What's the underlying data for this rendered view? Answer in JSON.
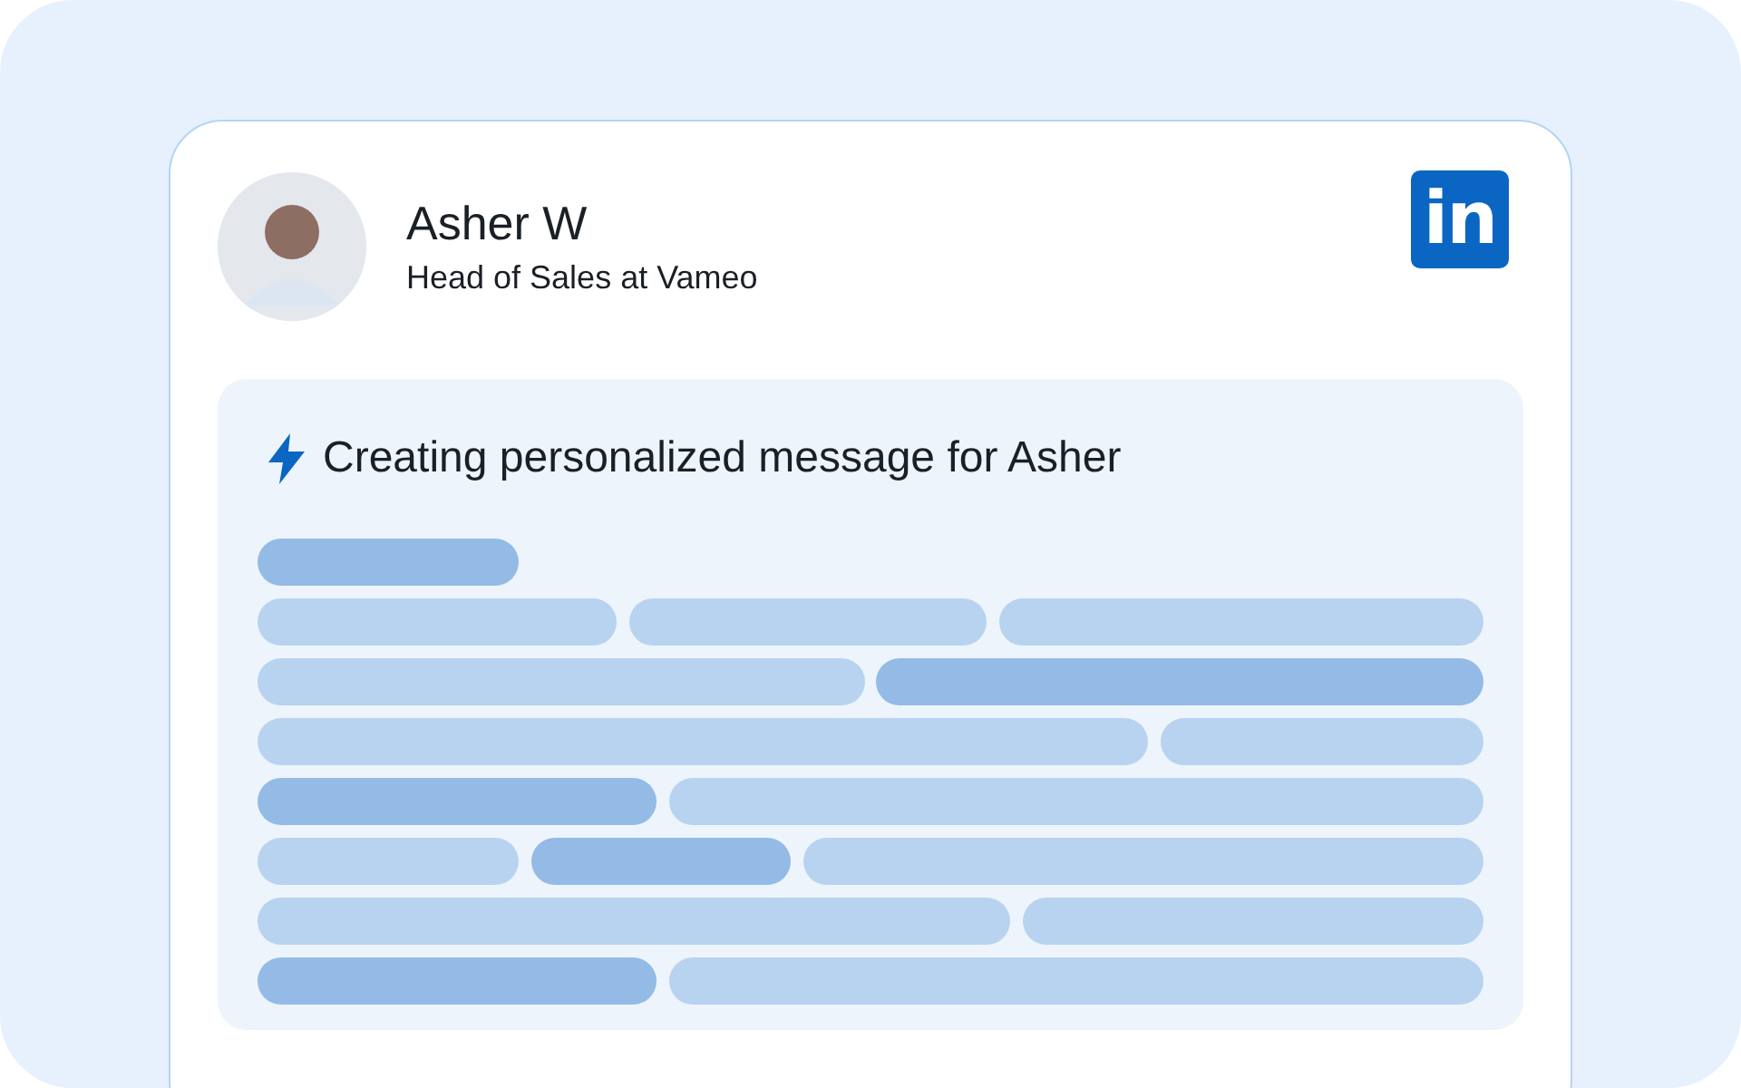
{
  "profile": {
    "name": "Asher W",
    "headline": "Head of Sales at Vameo",
    "logo": "in"
  },
  "message_panel": {
    "heading": "Creating personalized message for Asher"
  }
}
